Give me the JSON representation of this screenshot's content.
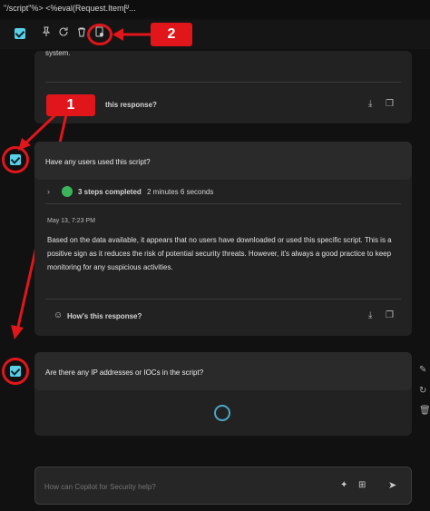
{
  "window": {
    "title": "\"/script\"%> <%eval(Request.Item[\"...",
    "chevron_icon": "chevron-down-icon"
  },
  "toolbar": {
    "select_all_checked": true,
    "icons": [
      "pin-icon",
      "refresh-icon",
      "delete-icon",
      "export-pin-icon"
    ]
  },
  "previous_response": {
    "tail_text": "system.",
    "feedback_label": "this response?"
  },
  "prompt_1": {
    "question": "Have any users used this script?",
    "steps_label": "3 steps completed",
    "duration": "2 minutes 6 seconds",
    "timestamp": "May 13, 7:23 PM",
    "answer": "Based on the data available, it appears that no users have downloaded or used this specific script. This is a positive sign as it reduces the risk of potential security threats. However, it's always a good practice to keep monitoring for any suspicious activities.",
    "feedback_label": "How's this response?"
  },
  "prompt_2": {
    "question": "Are there any IP addresses or IOCs in the script?"
  },
  "composer": {
    "placeholder": "How can Copilot for Security help?"
  },
  "annotations": {
    "badge_1": "1",
    "badge_2": "2",
    "color": "#e0161b"
  }
}
